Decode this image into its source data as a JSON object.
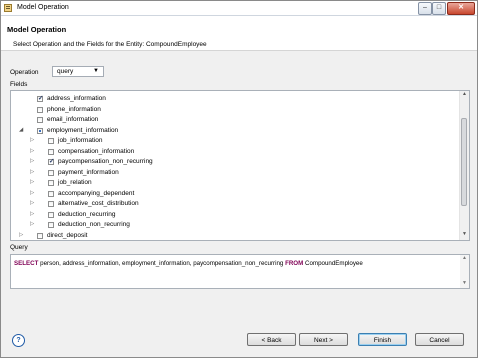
{
  "window": {
    "title": "Model Operation"
  },
  "header": {
    "title": "Model Operation",
    "description": "Select Operation and the Fields for the Entity: CompoundEmployee"
  },
  "operation": {
    "label": "Operation",
    "selected": "query"
  },
  "fields": {
    "label": "Fields",
    "tree": [
      {
        "label": "address_information",
        "checked": true,
        "depth": 0,
        "expander": ""
      },
      {
        "label": "phone_information",
        "checked": false,
        "depth": 0,
        "expander": ""
      },
      {
        "label": "email_information",
        "checked": false,
        "depth": 0,
        "expander": ""
      },
      {
        "label": "employment_information",
        "checked": "partial",
        "depth": 0,
        "expander": "expanded"
      },
      {
        "label": "job_information",
        "checked": false,
        "depth": 1,
        "expander": "collapsed"
      },
      {
        "label": "compensation_information",
        "checked": false,
        "depth": 1,
        "expander": "collapsed"
      },
      {
        "label": "paycompensation_non_recurring",
        "checked": true,
        "depth": 1,
        "expander": "collapsed"
      },
      {
        "label": "payment_information",
        "checked": false,
        "depth": 1,
        "expander": "collapsed"
      },
      {
        "label": "job_relation",
        "checked": false,
        "depth": 1,
        "expander": "collapsed"
      },
      {
        "label": "accompanying_dependent",
        "checked": false,
        "depth": 1,
        "expander": "collapsed"
      },
      {
        "label": "alternative_cost_distribution",
        "checked": false,
        "depth": 1,
        "expander": "collapsed"
      },
      {
        "label": "deduction_recurring",
        "checked": false,
        "depth": 1,
        "expander": "collapsed"
      },
      {
        "label": "deduction_non_recurring",
        "checked": false,
        "depth": 1,
        "expander": "collapsed"
      },
      {
        "label": "direct_deposit",
        "checked": false,
        "depth": 0,
        "expander": "collapsed"
      }
    ]
  },
  "query": {
    "label": "Query",
    "select_kw": "SELECT",
    "fields_text": "person, address_information, employment_information, paycompensation_non_recurring",
    "from_kw": "FROM",
    "entity": "CompoundEmployee"
  },
  "buttons": {
    "help": "?",
    "back": "< Back",
    "next": "Next >",
    "finish": "Finish",
    "cancel": "Cancel"
  },
  "icons": {
    "app": "model-operation-icon",
    "tree_expanded": "triangle-down-icon",
    "tree_collapsed": "triangle-right-icon"
  },
  "colors": {
    "sql_keyword": "#7f0055",
    "default_button_border": "#3c7fb1"
  }
}
